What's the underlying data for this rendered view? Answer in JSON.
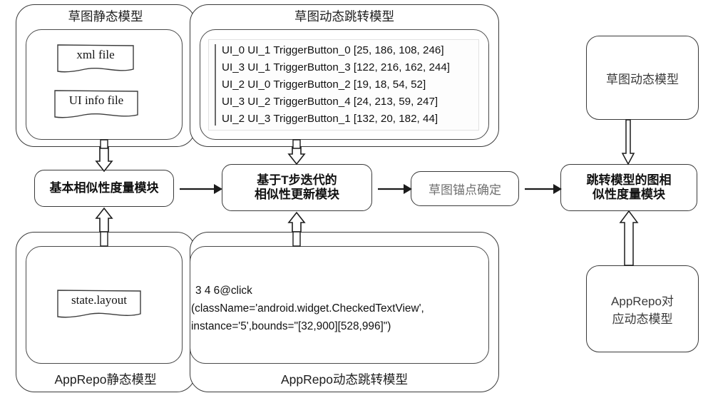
{
  "diagram": {
    "title": "AppRepo / 草图模型相似性度量流程图",
    "colors": {
      "stroke": "#3a3a3a",
      "panel_stroke": "#4a4a4a",
      "gray_text": "#6f6f6f",
      "background": "#ffffff"
    }
  },
  "top": {
    "static_group_label": "草图静态模型",
    "dynamic_group_label": "草图动态跳转模型",
    "files": [
      {
        "name": "xml file"
      },
      {
        "name": "UI info file"
      }
    ],
    "transitions": [
      "UI_0 UI_1 TriggerButton_0 [25, 186, 108, 246]",
      "UI_3 UI_1 TriggerButton_3 [122, 216, 162, 244]",
      "UI_2 UI_0 TriggerButton_2 [19, 18, 54, 52]",
      "UI_3 UI_2 TriggerButton_4 [24, 213, 59, 247]",
      "UI_2 UI_3 TriggerButton_1 [132, 20, 182, 44]"
    ]
  },
  "middle": {
    "modules": [
      {
        "id": "basic-similarity",
        "label": "基本相似性度量模块",
        "style": "bold"
      },
      {
        "id": "iterative-update",
        "label": "基于T步迭代的\n相似性更新模块",
        "line1": "基于T步迭代的",
        "line2": "相似性更新模块",
        "style": "bold"
      },
      {
        "id": "sketch-anchor",
        "label": "草图锚点确定",
        "style": "gray"
      },
      {
        "id": "transition-graph-similarity",
        "label": "跳转模型的图相\n似性度量模块",
        "line1": "跳转模型的图相",
        "line2": "似性度量模块",
        "style": "bold"
      }
    ]
  },
  "bottom": {
    "static_group_label": "AppRepo静态模型",
    "dynamic_group_label": "AppRepo动态跳转模型",
    "files": [
      {
        "name": "state.layout"
      }
    ],
    "code_lines": [
      "3 4 6@click",
      "(className='android.widget.CheckedTextView',",
      "instance='5',bounds=\"[32,900][528,996]\")"
    ]
  },
  "right": {
    "top_box_label": "草图动态模型",
    "bottom_box": {
      "line1": "AppRepo对",
      "line2": "应动态模型"
    }
  }
}
